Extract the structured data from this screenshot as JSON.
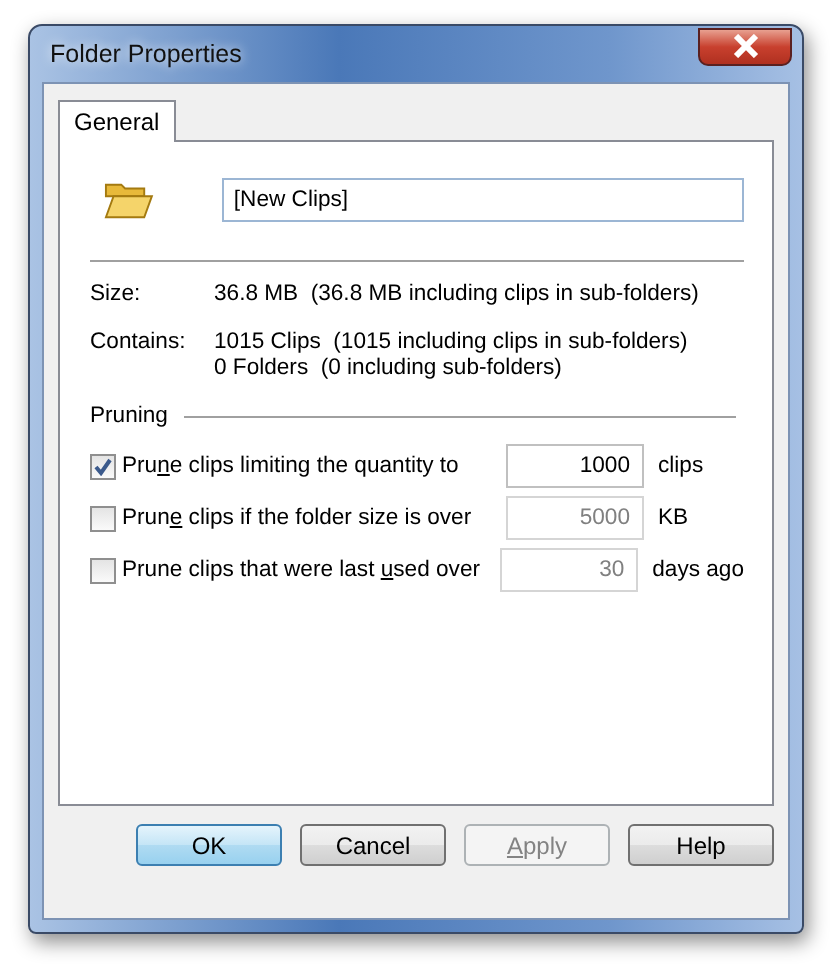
{
  "window": {
    "title": "Folder Properties"
  },
  "tabs": [
    {
      "label": "General",
      "selected": true
    }
  ],
  "name_field": {
    "value": "[New Clips]"
  },
  "info": [
    {
      "label": "Size:",
      "lines": [
        "36.8 MB  (36.8 MB including clips in sub-folders)"
      ]
    },
    {
      "label": "Contains:",
      "lines": [
        "1015 Clips  (1015 including clips in sub-folders)",
        "0 Folders  (0 including sub-folders)"
      ]
    }
  ],
  "pruning": {
    "title": "Pruning",
    "rules": [
      {
        "label": {
          "before": "Pru",
          "access_key": "n",
          "after": "e clips limiting the quantity to"
        },
        "checked": true,
        "value": "1000",
        "unit": "clips"
      },
      {
        "label": {
          "before": "Prun",
          "access_key": "e",
          "after": " clips if the folder size is over"
        },
        "checked": false,
        "value": "5000",
        "unit": "KB"
      },
      {
        "label": {
          "before": "Prune clips that were last ",
          "access_key": "u",
          "after": "sed over"
        },
        "checked": false,
        "value": "30",
        "unit": "days ago"
      }
    ]
  },
  "buttons": [
    {
      "label": {
        "before": "OK"
      },
      "kind": "default",
      "disabled": false
    },
    {
      "label": {
        "before": "Cancel"
      },
      "kind": "normal",
      "disabled": false
    },
    {
      "label": {
        "access_key": "A",
        "after": "pply"
      },
      "kind": "normal",
      "disabled": true
    },
    {
      "label": {
        "before": "Help"
      },
      "kind": "normal",
      "disabled": false
    }
  ]
}
